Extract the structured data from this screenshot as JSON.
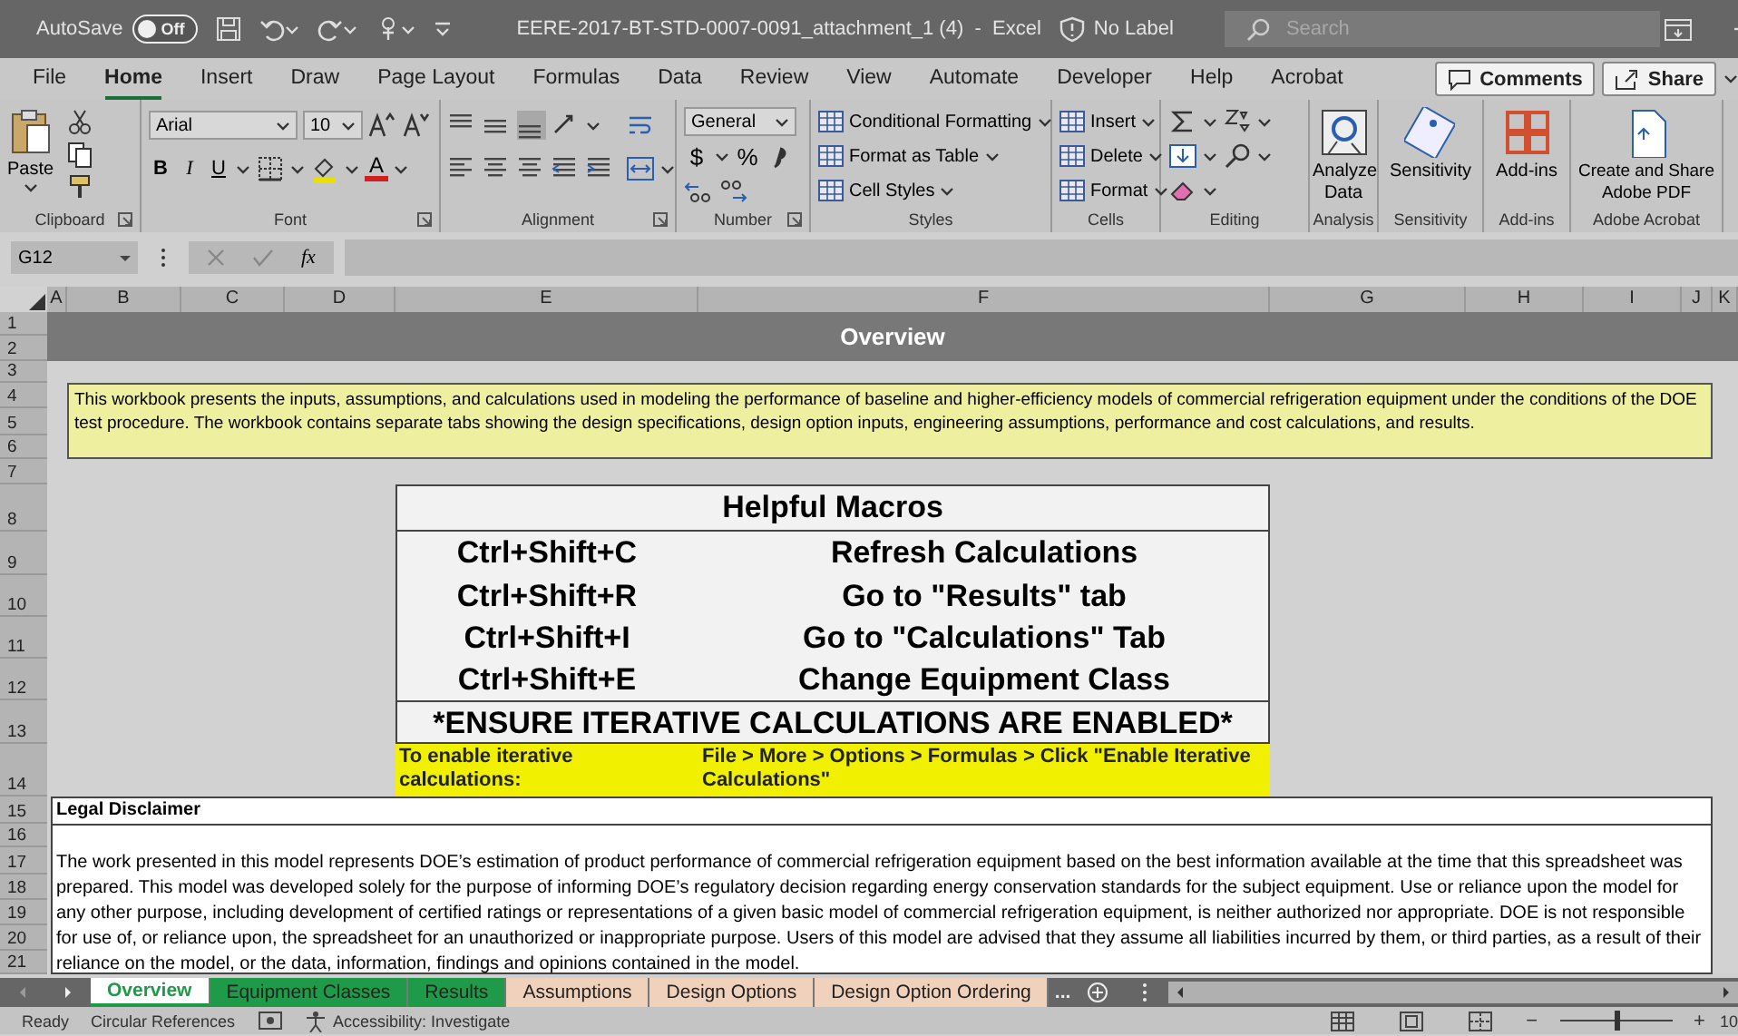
{
  "titlebar": {
    "autosave_label": "AutoSave",
    "autosave_toggle": {
      "label": "Off",
      "on": false
    },
    "document_title": "EERE-2017-BT-STD-0007-0091_attachment_1 (4)  -  Excel",
    "sensitivity_label": "No Label",
    "search": {
      "placeholder": "Search"
    }
  },
  "ribbon_tabs": [
    {
      "label": "File",
      "selected": false
    },
    {
      "label": "Home",
      "selected": true
    },
    {
      "label": "Insert",
      "selected": false
    },
    {
      "label": "Draw",
      "selected": false
    },
    {
      "label": "Page Layout",
      "selected": false
    },
    {
      "label": "Formulas",
      "selected": false
    },
    {
      "label": "Data",
      "selected": false
    },
    {
      "label": "Review",
      "selected": false
    },
    {
      "label": "View",
      "selected": false
    },
    {
      "label": "Automate",
      "selected": false
    },
    {
      "label": "Developer",
      "selected": false
    },
    {
      "label": "Help",
      "selected": false
    },
    {
      "label": "Acrobat",
      "selected": false
    }
  ],
  "ribbon_buttons": [
    "Comments",
    "Share"
  ],
  "ribbon_groups": [
    {
      "kind": "clipboard",
      "label": "Clipboard",
      "paste": "Paste"
    },
    {
      "kind": "font",
      "label": "Font",
      "font_name": "Arial",
      "font_size": "10",
      "bold": "B",
      "italic": "I",
      "underline": "U",
      "font_color": "A"
    },
    {
      "kind": "alignment",
      "label": "Alignment"
    },
    {
      "kind": "number",
      "label": "Number",
      "format": "General",
      "currency": "$",
      "percent": "%"
    },
    {
      "kind": "commands",
      "label": "Styles",
      "commands": [
        "Conditional Formatting",
        "Format as Table",
        "Cell Styles"
      ]
    },
    {
      "kind": "commands",
      "label": "Cells",
      "commands": [
        "Insert",
        "Delete",
        "Format"
      ]
    },
    {
      "kind": "editing",
      "label": "Editing"
    },
    {
      "kind": "large",
      "label": "Analysis",
      "command": "Analyze Data"
    },
    {
      "kind": "large",
      "label": "Sensitivity",
      "command": "Sensitivity"
    },
    {
      "kind": "large",
      "label": "Add-ins",
      "command": "Add-ins"
    },
    {
      "kind": "large",
      "label": "Adobe Acrobat",
      "command": "Create and Share Adobe PDF"
    }
  ],
  "formula_bar": {
    "name_box": "G12",
    "function_label": "fx"
  },
  "grid": {
    "columns": [
      "A",
      "B",
      "C",
      "D",
      "E",
      "F",
      "G",
      "H",
      "I",
      "J",
      "K"
    ],
    "rows": [
      "1",
      "2",
      "3",
      "4",
      "5",
      "6",
      "7",
      "8",
      "9",
      "10",
      "11",
      "12",
      "13",
      "14",
      "15",
      "16",
      "17",
      "18",
      "19",
      "20",
      "21"
    ]
  },
  "sheet": {
    "title": "Overview",
    "intro": "This workbook presents the inputs, assumptions, and calculations used in modeling the performance of baseline and higher-efficiency models of commercial refrigeration equipment under the conditions of the DOE test procedure. The workbook contains separate tabs showing the design specifications, design option inputs, engineering assumptions, performance and cost calculations, and results.",
    "macros": {
      "title": "Helpful Macros",
      "items": [
        {
          "shortcut": "Ctrl+Shift+C",
          "action": "Refresh Calculations"
        },
        {
          "shortcut": "Ctrl+Shift+R",
          "action": "Go to \"Results\" tab"
        },
        {
          "shortcut": "Ctrl+Shift+I",
          "action": "Go to \"Calculations\" Tab"
        },
        {
          "shortcut": "Ctrl+Shift+E",
          "action": "Change Equipment Class"
        }
      ],
      "warning": "*ENSURE ITERATIVE CALCULATIONS ARE ENABLED*"
    },
    "iterative_note": {
      "label": "To enable iterative calculations:",
      "steps": "File > More > Options > Formulas > Click \"Enable Iterative Calculations\""
    },
    "disclaimer": {
      "title": "Legal Disclaimer",
      "text": "The work presented in this model represents DOE’s estimation of product performance of commercial refrigeration equipment based on the best information available at the time that this spreadsheet was prepared.  This model was developed solely for the purpose of informing DOE’s regulatory decision regarding energy conservation standards for the subject equipment.  Use or reliance upon the model for any other purpose, including development of certified ratings or representations of a given basic model of commercial refrigeration equipment, is neither authorized nor appropriate.  DOE is not responsible for use of, or reliance upon, the spreadsheet for an unauthorized or inappropriate purpose. Users of this model are advised that they assume all liabilities incurred by them, or third parties, as a result of their reliance on the model, or the data, information, findings and opinions contained in the model."
    }
  },
  "sheet_tabs": [
    {
      "label": "Overview",
      "selected": true,
      "color": "#1e9a48"
    },
    {
      "label": "Equipment Classes",
      "selected": false,
      "color": "#1e9a48"
    },
    {
      "label": "Results",
      "selected": false,
      "color": "#1e9a48"
    },
    {
      "label": "Assumptions",
      "selected": false,
      "color": "#f0d2bc"
    },
    {
      "label": "Design Options",
      "selected": false,
      "color": "#f0d2bc"
    },
    {
      "label": "Design Option Ordering",
      "selected": false,
      "color": "#f0d2bc"
    }
  ],
  "tabs_overflow": "...",
  "status_bar": {
    "mode": "Ready",
    "circular": "Circular References",
    "accessibility": "Accessibility: Investigate",
    "zoom": {
      "minus": "−",
      "plus": "+",
      "level": 0.5,
      "percent": "10"
    }
  }
}
